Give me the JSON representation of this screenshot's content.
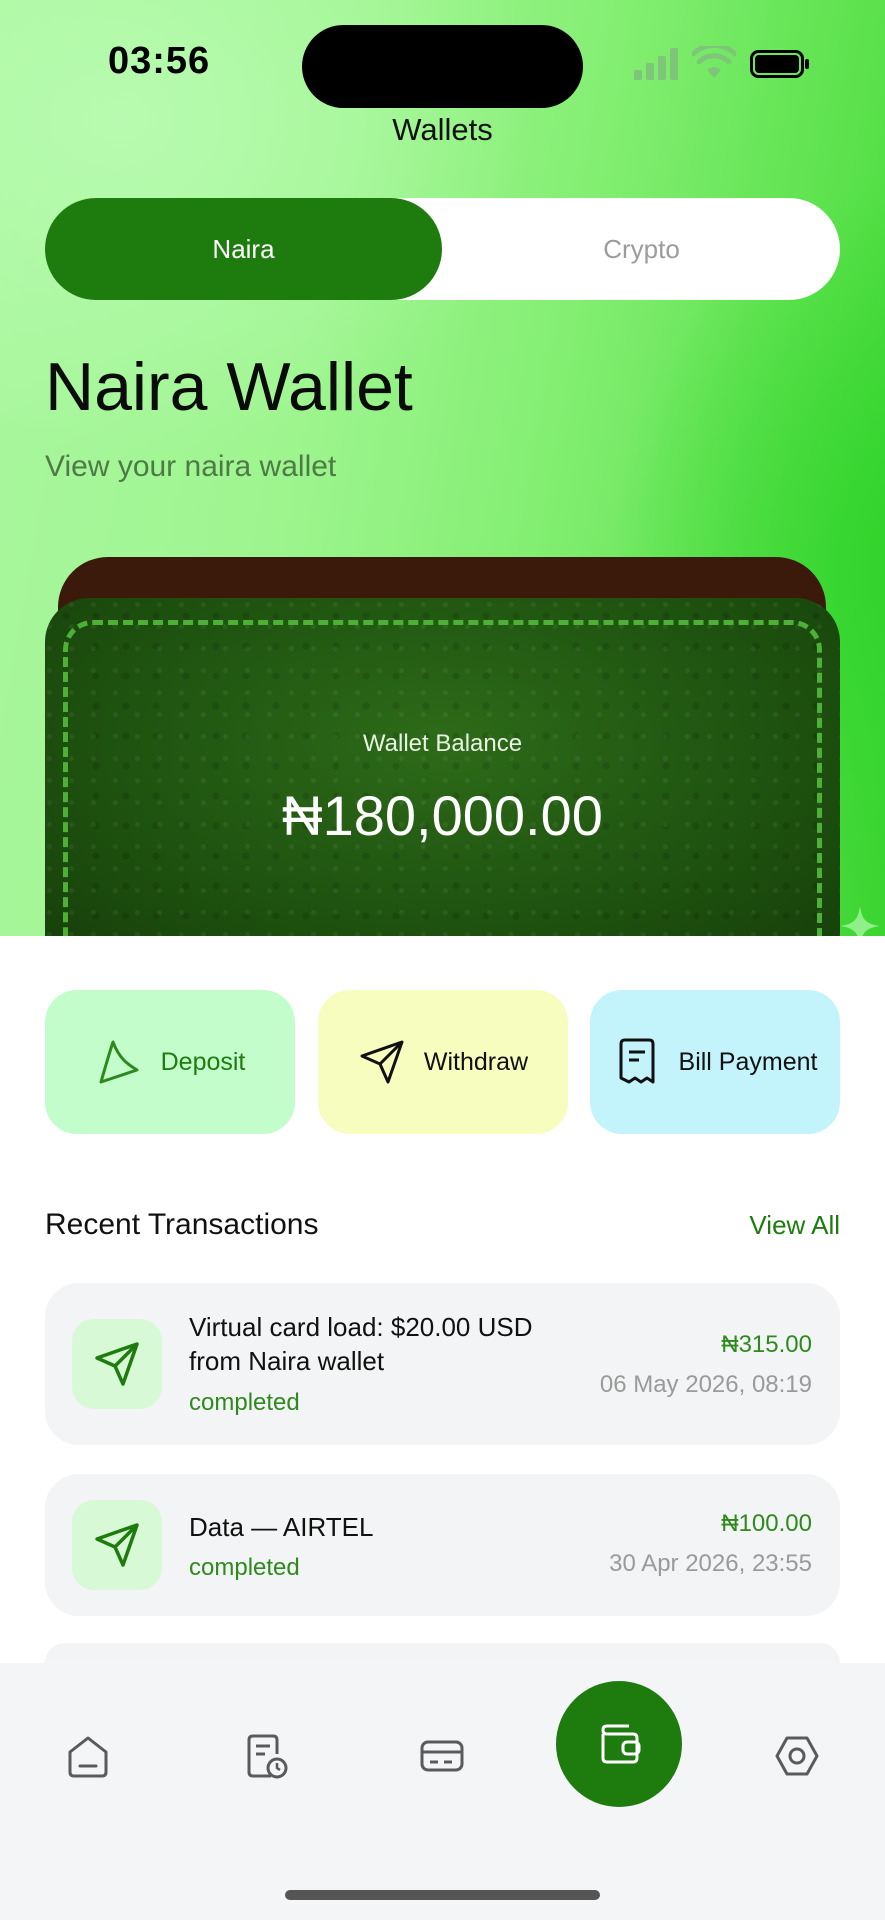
{
  "status_bar": {
    "time": "03:56"
  },
  "header": {
    "title": "Wallets"
  },
  "tabs": [
    {
      "label": "Naira",
      "active": true
    },
    {
      "label": "Crypto",
      "active": false
    }
  ],
  "wallet": {
    "title": "Naira Wallet",
    "subtitle": "View your naira wallet",
    "balance_label": "Wallet Balance",
    "balance": "₦180,000.00"
  },
  "actions": [
    {
      "label": "Deposit",
      "icon": "deposit-icon"
    },
    {
      "label": "Withdraw",
      "icon": "send-icon"
    },
    {
      "label": "Bill Payment",
      "icon": "receipt-icon"
    }
  ],
  "recent": {
    "title": "Recent Transactions",
    "view_all": "View All",
    "items": [
      {
        "description": "Virtual card load: $20.00 USD from Naira wallet",
        "status": "completed",
        "amount": "₦315.00",
        "date": "06 May 2026, 08:19"
      },
      {
        "description": "Data — AIRTEL",
        "status": "completed",
        "amount": "₦100.00",
        "date": "30 Apr 2026, 23:55"
      }
    ]
  },
  "nav": {
    "items": [
      "home-icon",
      "history-icon",
      "card-icon",
      "wallet-icon",
      "settings-icon"
    ],
    "active": "wallet-icon"
  },
  "colors": {
    "primary": "#1e7c0f",
    "deposit_bg": "#c3fdcc",
    "withdraw_bg": "#f6fdbf",
    "bill_bg": "#c3f4fb",
    "success": "#2f8a1d"
  }
}
